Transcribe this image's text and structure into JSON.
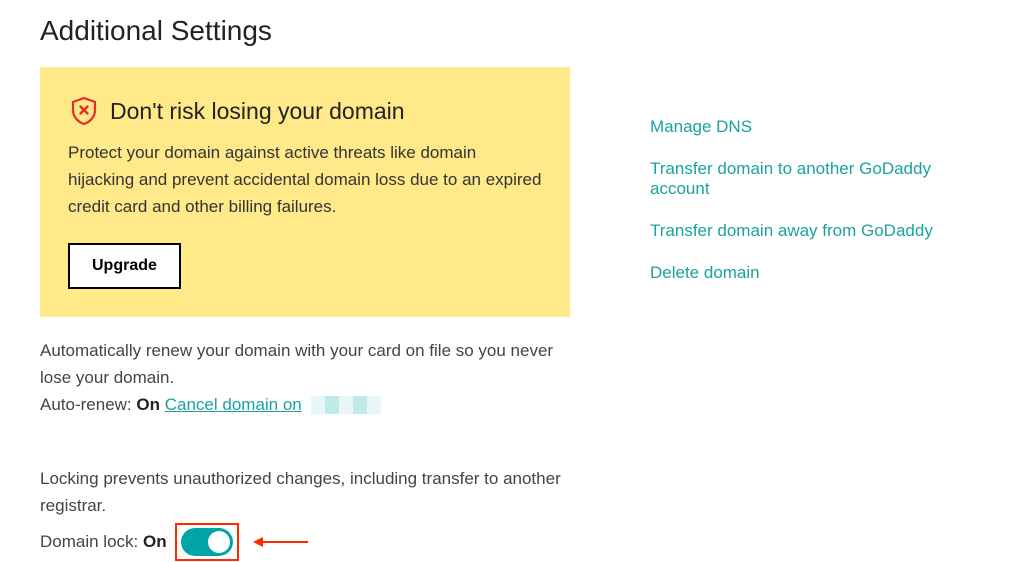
{
  "page_title": "Additional Settings",
  "warning": {
    "title": "Don't risk losing your domain",
    "description": "Protect your domain against active threats like domain hijacking and prevent accidental domain loss due to an expired credit card and other billing failures.",
    "button_label": "Upgrade"
  },
  "auto_renew": {
    "description": "Automatically renew your domain with your card on file so you never lose your domain.",
    "label": "Auto-renew: ",
    "value": "On",
    "cancel_link_text": "Cancel domain on"
  },
  "domain_lock": {
    "description": "Locking prevents unauthorized changes, including transfer to another registrar.",
    "label": "Domain lock: ",
    "value": "On"
  },
  "action_links": [
    "Manage DNS",
    "Transfer domain to another GoDaddy account",
    "Transfer domain away from GoDaddy",
    "Delete domain"
  ]
}
